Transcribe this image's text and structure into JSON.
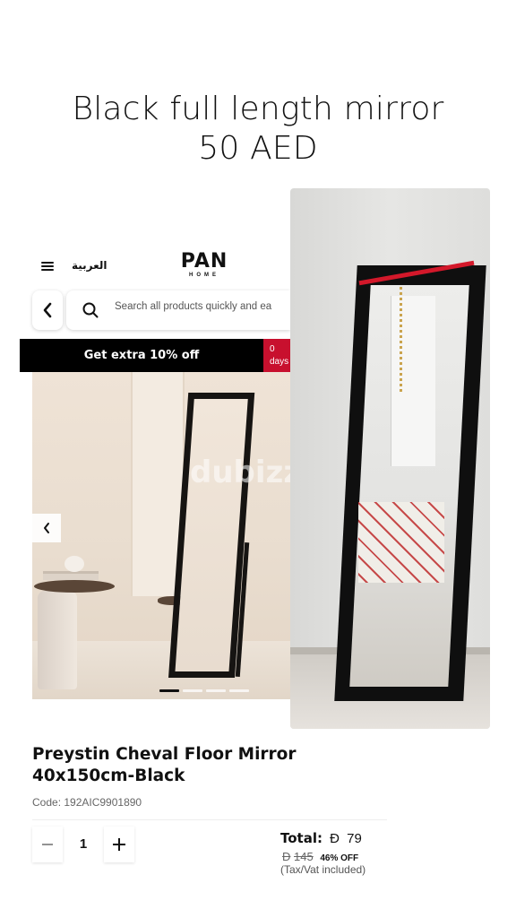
{
  "headline": {
    "line1": "Black full length mirror",
    "line2": "50 AED"
  },
  "shop": {
    "language_label": "العربية",
    "logo": {
      "main": "PAN",
      "sub": "HOME"
    },
    "search": {
      "placeholder": "Search all products quickly and ea"
    },
    "promo": {
      "text": "Get extra 10% off",
      "countdown_value": "0",
      "countdown_unit": "days"
    },
    "image_watermark": "dubizzle",
    "carousel": {
      "slide_count": 4,
      "active_index": 0
    }
  },
  "product": {
    "title": "Preystin Cheval Floor Mirror 40x150cm-Black",
    "code": "Code: 192AIC9901890",
    "quantity": "1",
    "total_label": "Total:",
    "currency_symbol": "Ð",
    "total_price": "79",
    "old_price": "145",
    "discount": "46% OFF",
    "tax_note": "(Tax/Vat included)"
  },
  "colors": {
    "accent_red": "#c8102e",
    "promo_bg": "#000000",
    "mirror_frame": "#0f0f0f"
  }
}
